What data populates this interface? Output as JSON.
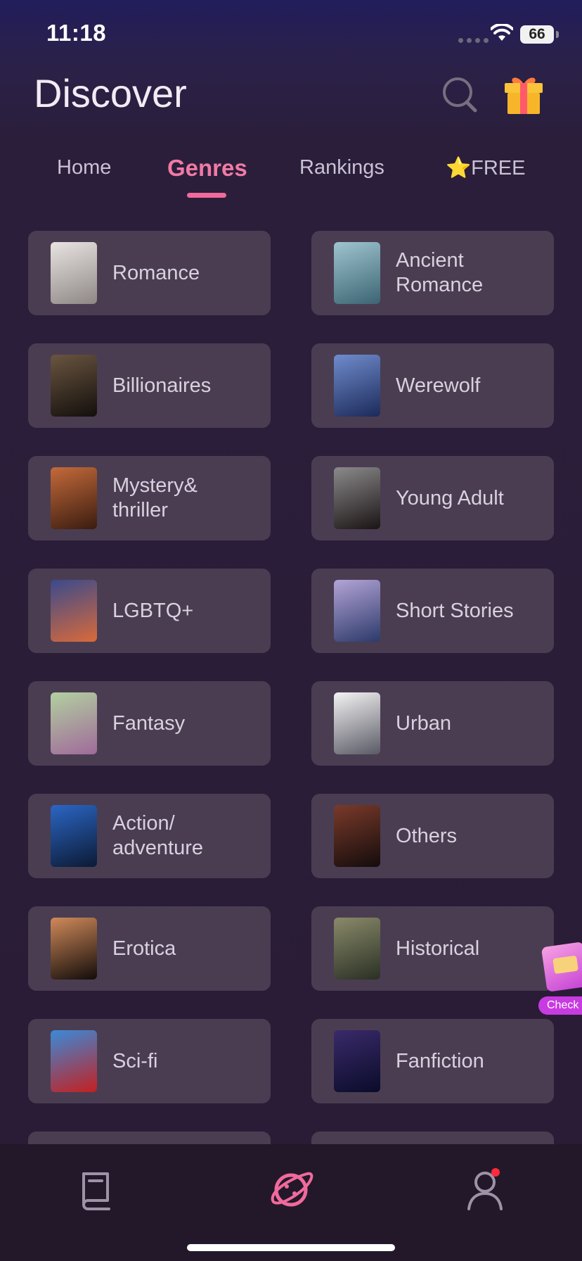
{
  "status_bar": {
    "time": "11:18",
    "battery": "66"
  },
  "header": {
    "title": "Discover",
    "search_icon": "search-icon",
    "gift_icon": "gift-icon"
  },
  "tabs": [
    {
      "label": "Home",
      "active": false
    },
    {
      "label": "Genres",
      "active": true
    },
    {
      "label": "Rankings",
      "active": false
    },
    {
      "label": "⭐FREE",
      "active": false
    }
  ],
  "genres": [
    {
      "label": "Romance",
      "cover": [
        "#e8e4e2",
        "#8e8785"
      ]
    },
    {
      "label": "Ancient\nRomance",
      "cover": [
        "#9fc4d0",
        "#3c6472"
      ]
    },
    {
      "label": "Billionaires",
      "cover": [
        "#6a5540",
        "#130f0c"
      ]
    },
    {
      "label": "Werewolf",
      "cover": [
        "#6f8ccc",
        "#1c2a5a"
      ]
    },
    {
      "label": "Mystery&\nthriller",
      "cover": [
        "#c46a3a",
        "#3a1c10"
      ]
    },
    {
      "label": "Young Adult",
      "cover": [
        "#8c8a8c",
        "#1a1414"
      ]
    },
    {
      "label": "LGBTQ+",
      "cover": [
        "#3a4a8c",
        "#d96a3a"
      ]
    },
    {
      "label": "Short Stories",
      "cover": [
        "#b3a4d6",
        "#2c3a6a"
      ]
    },
    {
      "label": "Fantasy",
      "cover": [
        "#b2d0a0",
        "#a06a9a"
      ]
    },
    {
      "label": "Urban",
      "cover": [
        "#f3f3f3",
        "#5a5a66"
      ]
    },
    {
      "label": "Action/\nadventure",
      "cover": [
        "#2b66c4",
        "#0c1a34"
      ]
    },
    {
      "label": "Others",
      "cover": [
        "#7a3a2a",
        "#140c0c"
      ]
    },
    {
      "label": "Erotica",
      "cover": [
        "#d08a5a",
        "#120c0a"
      ]
    },
    {
      "label": "Historical",
      "cover": [
        "#8a8a6a",
        "#2a3024"
      ]
    },
    {
      "label": "Sci-fi",
      "cover": [
        "#3a8ad8",
        "#c42020"
      ]
    },
    {
      "label": "Fanfiction",
      "cover": [
        "#3a2a6a",
        "#0a0c2a"
      ]
    }
  ],
  "floating_badge": {
    "label": "Check"
  },
  "bottom_nav": [
    {
      "name": "library",
      "icon": "book-icon",
      "active": false
    },
    {
      "name": "discover",
      "icon": "planet-icon",
      "active": true
    },
    {
      "name": "profile",
      "icon": "user-icon",
      "active": false,
      "notification": true
    }
  ],
  "colors": {
    "accent": "#f06a9c",
    "card_bg": "#4a3d52",
    "nav_inactive": "#9c94a6",
    "notification": "#ff2a3b"
  }
}
